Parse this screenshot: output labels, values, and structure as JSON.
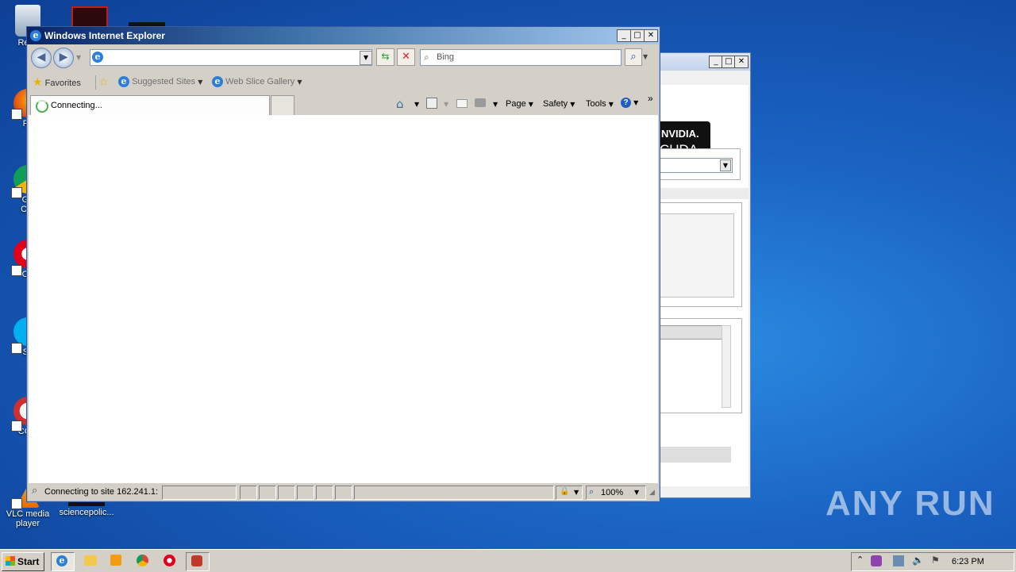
{
  "desktop": {
    "icons": [
      {
        "label": "Recy",
        "name": "recycle-bin-icon"
      },
      {
        "label": "Fir",
        "name": "firefox-icon"
      },
      {
        "label": "Go Chr",
        "name": "google-chrome-icon"
      },
      {
        "label": "Op",
        "name": "opera-icon"
      },
      {
        "label": "Sk",
        "name": "skype-icon"
      },
      {
        "label": "CCle",
        "name": "ccleaner-icon"
      },
      {
        "label": "VLC media player",
        "name": "vlc-icon"
      },
      {
        "label": "sciencepolic...",
        "name": "file-icon"
      }
    ]
  },
  "background_window": {
    "logo_line1": "NVIDIA.",
    "logo_line2": "CUDA."
  },
  "ie": {
    "title": "Windows Internet Explorer",
    "address_value": "",
    "search_placeholder": "Bing",
    "favorites": {
      "favorites_label": "Favorites",
      "suggested_sites": "Suggested Sites",
      "web_slice_gallery": "Web Slice Gallery"
    },
    "tab_label": "Connecting...",
    "commands": {
      "page": "Page",
      "safety": "Safety",
      "tools": "Tools",
      "more": "»"
    },
    "status": {
      "text": "Connecting to site 162.241.1:",
      "zoom": "100%"
    }
  },
  "taskbar": {
    "start_label": "Start",
    "clock": "6:23 PM"
  },
  "watermark": "ANY RUN"
}
